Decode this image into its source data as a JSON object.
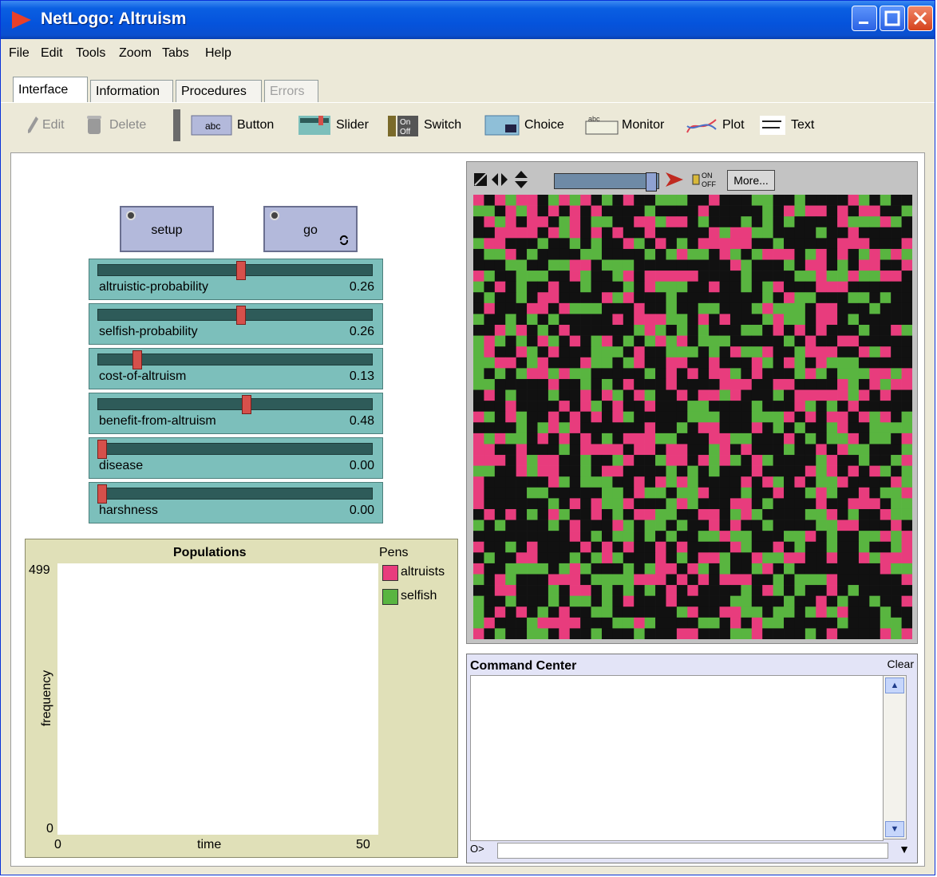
{
  "window": {
    "title": "NetLogo: Altruism"
  },
  "menu": [
    "File",
    "Edit",
    "Tools",
    "Zoom",
    "Tabs",
    "Help"
  ],
  "tabs": [
    {
      "label": "Interface",
      "active": true
    },
    {
      "label": "Information"
    },
    {
      "label": "Procedures"
    },
    {
      "label": "Errors",
      "disabled": true
    }
  ],
  "toolbar": {
    "edit": "Edit",
    "delete": "Delete",
    "button": "Button",
    "slider": "Slider",
    "switch": "Switch",
    "choice": "Choice",
    "monitor": "Monitor",
    "plot": "Plot",
    "text": "Text"
  },
  "buttons": {
    "setup": "setup",
    "go": "go"
  },
  "sliders": [
    {
      "name": "altruistic-probability",
      "value": "0.26",
      "fraction": 0.52
    },
    {
      "name": "selfish-probability",
      "value": "0.26",
      "fraction": 0.52
    },
    {
      "name": "cost-of-altruism",
      "value": "0.13",
      "fraction": 0.13
    },
    {
      "name": "benefit-from-altruism",
      "value": "0.48",
      "fraction": 0.54
    },
    {
      "name": "disease",
      "value": "0.00",
      "fraction": 0
    },
    {
      "name": "harshness",
      "value": "0.00",
      "fraction": 0
    }
  ],
  "plot": {
    "title": "Populations",
    "pens_label": "Pens",
    "ymax": "499",
    "ymin": "0",
    "xmin": "0",
    "xmax": "50",
    "xlabel": "time",
    "ylabel": "frequency",
    "pens": [
      {
        "name": "altruists",
        "color": "#e83c7d"
      },
      {
        "name": "selfish",
        "color": "#59b540"
      }
    ]
  },
  "view": {
    "more": "More..."
  },
  "world_colors": {
    "black": "#111111",
    "pink": "#e83c7d",
    "green": "#59b540"
  },
  "command_center": {
    "title": "Command Center",
    "clear": "Clear",
    "prompt": "O>"
  }
}
